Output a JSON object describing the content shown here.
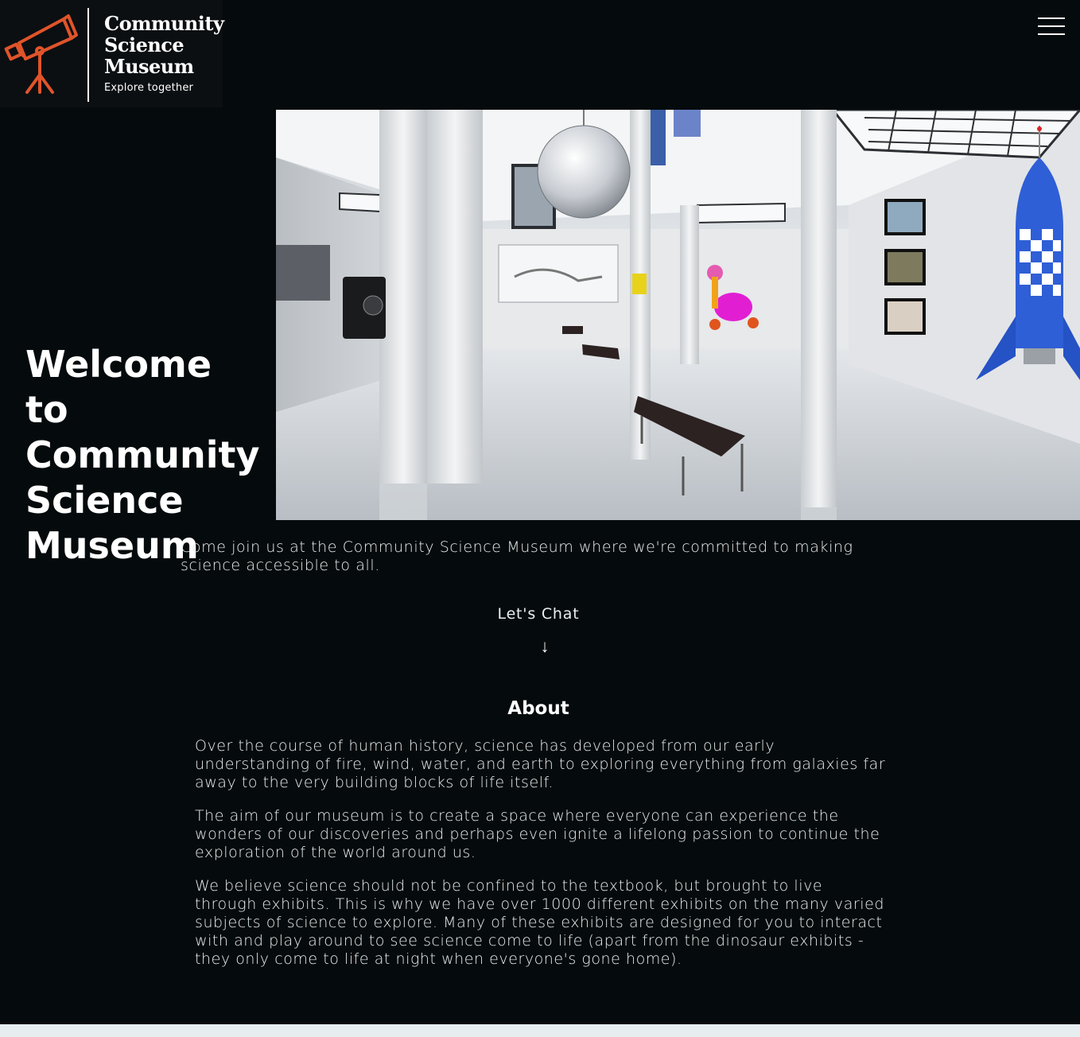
{
  "header": {
    "logo": {
      "icon": "telescope-icon",
      "title_lines": [
        "Community",
        "Science",
        "Museum"
      ],
      "tagline": "Explore together",
      "accent_color": "#e0542a"
    },
    "menu_icon": "hamburger-menu-icon"
  },
  "hero": {
    "title": "Welcome to Community Science Museum",
    "image_alt": "Museum gallery interior with exhibits, benches and a blue rocket"
  },
  "intro": {
    "text": "Come join us at the Community Science Museum where we're committed to making science accessible to all."
  },
  "cta": {
    "label": "Let's Chat",
    "arrow": "↓"
  },
  "about": {
    "heading": "About",
    "paragraphs": [
      "Over the course of human history, science has developed from our early understanding of fire, wind, water, and earth to exploring everything from galaxies far away to the very building blocks of life itself.",
      "The aim of our museum is to create a space where everyone can experience the wonders of our discoveries and perhaps even ignite a lifelong passion to continue the exploration of the world around us.",
      "We believe science should not be confined to the textbook, but brought to live through exhibits. This is why we have over 1000 different exhibits on the many varied subjects of science to explore. Many of these exhibits are designed for you to interact with and play around to see science come to life (apart from the dinosaur exhibits - they only come to life at night when everyone's gone home)."
    ]
  },
  "colors": {
    "background": "#050a0c",
    "text": "#e9eef0",
    "footer_strip": "#e7eef0"
  }
}
